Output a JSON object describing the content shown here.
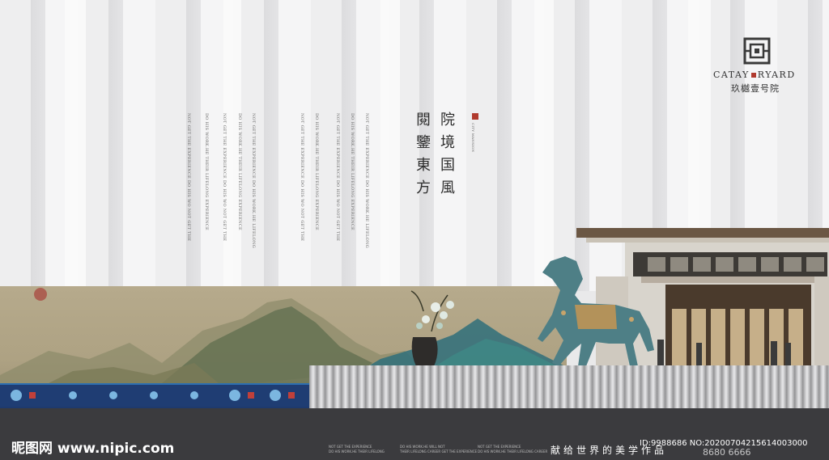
{
  "logo": {
    "en_left": "CATAY",
    "en_right": "RYARD",
    "cn": "玖樾壹号院"
  },
  "headline": {
    "col1": "院境国風",
    "col2": "閱鑒東方"
  },
  "seal_text": "CITY MANSION",
  "vertical_copy": [
    "NOT GET THE EXPERIENCE DO HIS WORK.HE LIFELONG",
    "DO HIS WORK.HE THEIR LIFELONG EXPERIENCE",
    "NOT GET THE EXPERIENCE DO HIS WO NOT GET THE",
    "NOT GET THE EXPERIENCE DO HIS WORK.HE LIFELONG",
    "DO HIS WORK.HE THEIR LIFELONG EXPERIENCE",
    "NOT GET THE EXPERIENCE DO HIS WO NOT GET THE"
  ],
  "vertical_copy_right": [
    "NOT GET THE EXPERIENCE DO HIS WORK.HE LIFELONG",
    "DO HIS WORK.HE THEIR LIFELONG EXPERIENCE",
    "NOT GET THE EXPERIENCE DO HIS WO NOT GET THE",
    "DO HIS WORK.HE THEIR LIFELONG EXPERIENCE",
    "NOT GET THE EXPERIENCE DO HIS WO NOT GET THE",
    "NOT GET THE EXPERIENCE DO HIS WORK.HE LIFELONG"
  ],
  "footer": {
    "watermark": "昵图网 www.nipic.com",
    "small_1a": "NOT GET THE EXPERIENCE",
    "small_1b": "DO HIS WORK.HE THEIR LIFELONG",
    "small_2a": "DO HIS WORK.HE WILL NOT",
    "small_2b": "THEIR LIFELONG CAREER GET THE EXPERIENCE",
    "small_3a": "NOT GET THE EXPERIENCE",
    "small_3b": "DO HIS WORK.HE THEIR LIFELONG CAREER",
    "slogan": "献给世界的美学作品",
    "id": "ID:9988686 NO:20200704215614003000",
    "phone": "8680 6666"
  },
  "colors": {
    "bottom_bar": "#3b3b3e",
    "seal_red": "#b03a2e",
    "horse": "#4e7f86"
  }
}
